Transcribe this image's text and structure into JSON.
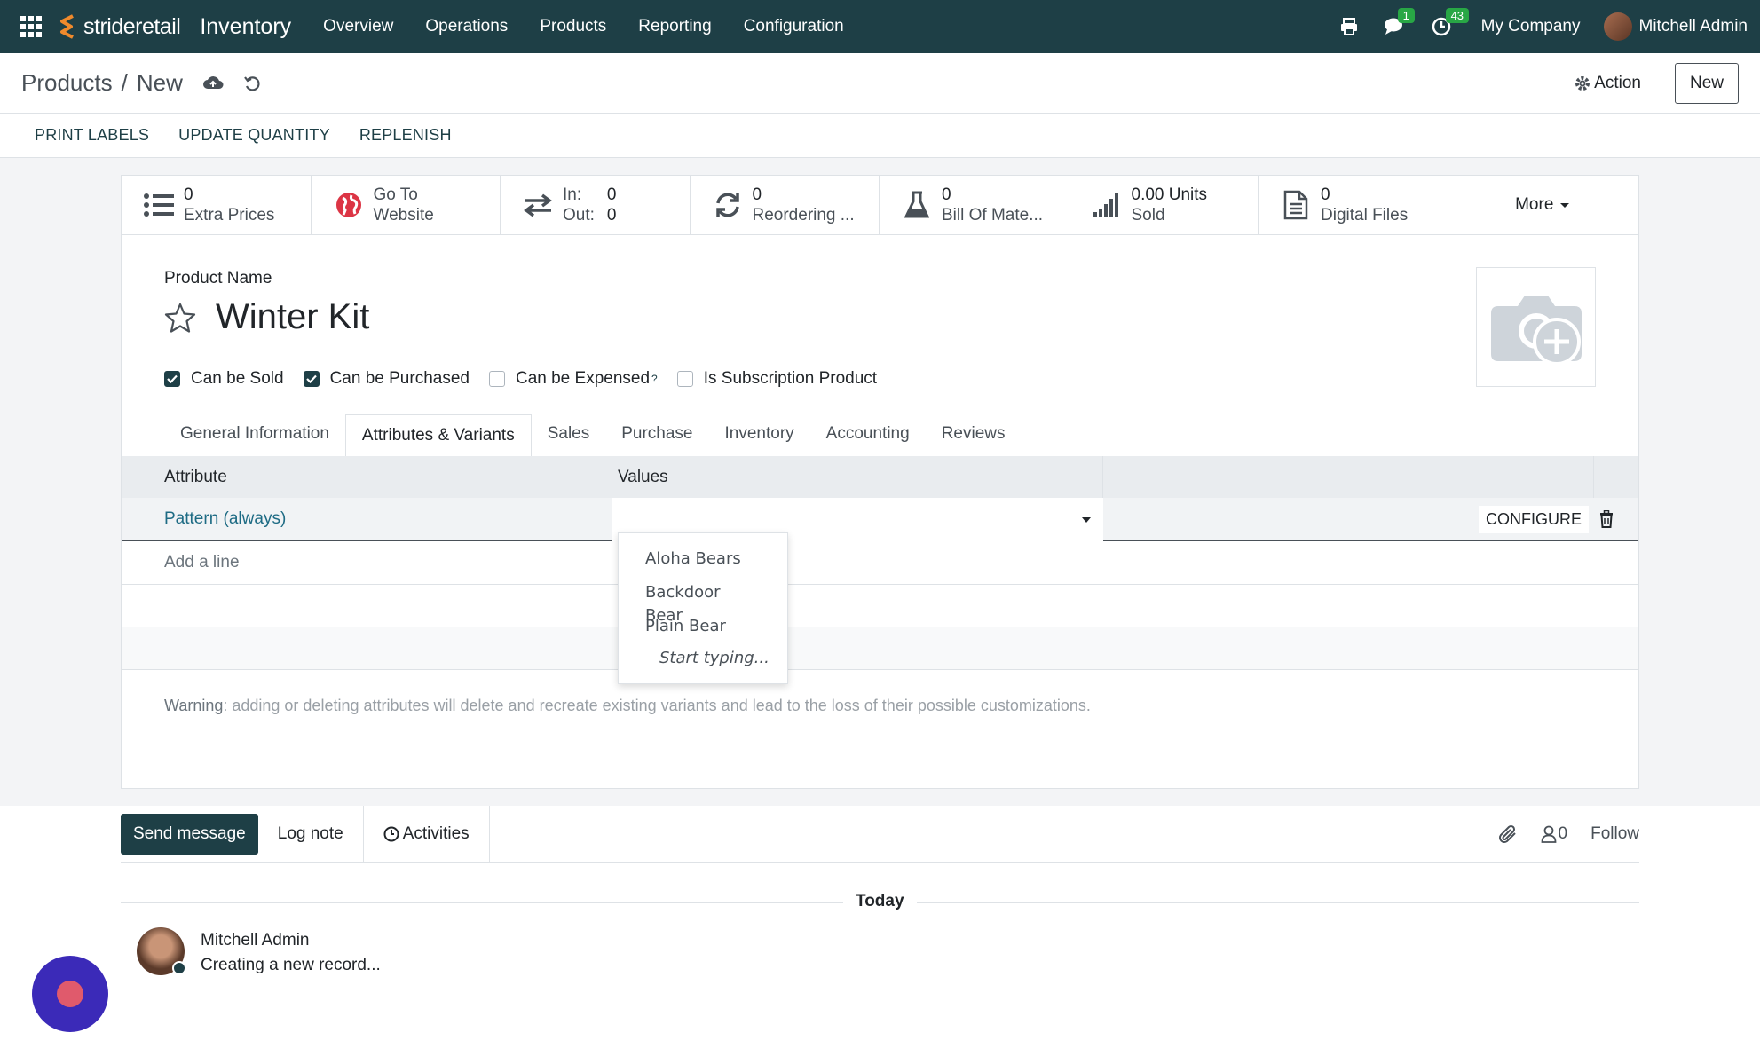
{
  "navbar": {
    "logo_text": "strideretail",
    "app_name": "Inventory",
    "menu": [
      "Overview",
      "Operations",
      "Products",
      "Reporting",
      "Configuration"
    ],
    "messages_badge": "1",
    "activities_badge": "43",
    "company": "My Company",
    "user": "Mitchell Admin"
  },
  "control_panel": {
    "breadcrumb_parent": "Products",
    "breadcrumb_sep": "/",
    "breadcrumb_current": "New",
    "action_label": "Action",
    "new_label": "New"
  },
  "statusbar": {
    "buttons": [
      "PRINT LABELS",
      "UPDATE QUANTITY",
      "REPLENISH"
    ]
  },
  "smart_buttons": {
    "extra_prices": {
      "value": "0",
      "label": "Extra Prices"
    },
    "website": {
      "line1": "Go To",
      "line2": "Website"
    },
    "inout": {
      "in_label": "In:",
      "in_value": "0",
      "out_label": "Out:",
      "out_value": "0"
    },
    "reordering": {
      "value": "0",
      "label": "Reordering ..."
    },
    "bom": {
      "value": "0",
      "label": "Bill Of Mate..."
    },
    "sold": {
      "value": "0.00 Units",
      "label": "Sold"
    },
    "digital": {
      "value": "0",
      "label": "Digital Files"
    },
    "more": "More"
  },
  "product": {
    "name_label": "Product Name",
    "name": "Winter Kit",
    "checks": [
      {
        "label": "Can be Sold",
        "checked": true
      },
      {
        "label": "Can be Purchased",
        "checked": true
      },
      {
        "label": "Can be Expensed",
        "checked": false,
        "help": "?"
      },
      {
        "label": "Is Subscription Product",
        "checked": false
      }
    ]
  },
  "tabs": [
    "General Information",
    "Attributes & Variants",
    "Sales",
    "Purchase",
    "Inventory",
    "Accounting",
    "Reviews"
  ],
  "active_tab": "Attributes & Variants",
  "attributes_table": {
    "headers": {
      "attribute": "Attribute",
      "values": "Values"
    },
    "rows": [
      {
        "attribute": "Pattern (always)",
        "configure": "CONFIGURE"
      }
    ],
    "add_line": "Add a line",
    "warning_label": "Warning",
    "warning_text": ": adding or deleting attributes will delete and recreate existing variants and lead to the loss of their possible customizations."
  },
  "dropdown": {
    "options": [
      "Aloha Bears",
      "Backdoor Bear",
      "Plain Bear"
    ],
    "hint": "Start typing..."
  },
  "chatter": {
    "send_message": "Send message",
    "log_note": "Log note",
    "activities": "Activities",
    "followers_count": "0",
    "follow": "Follow",
    "today": "Today",
    "message": {
      "author": "Mitchell Admin",
      "body": "Creating a new record..."
    }
  },
  "colors": {
    "navbar": "#1e3f46",
    "badge": "#28a745",
    "link": "#1e6b84",
    "fab": "#3b2ab8"
  }
}
